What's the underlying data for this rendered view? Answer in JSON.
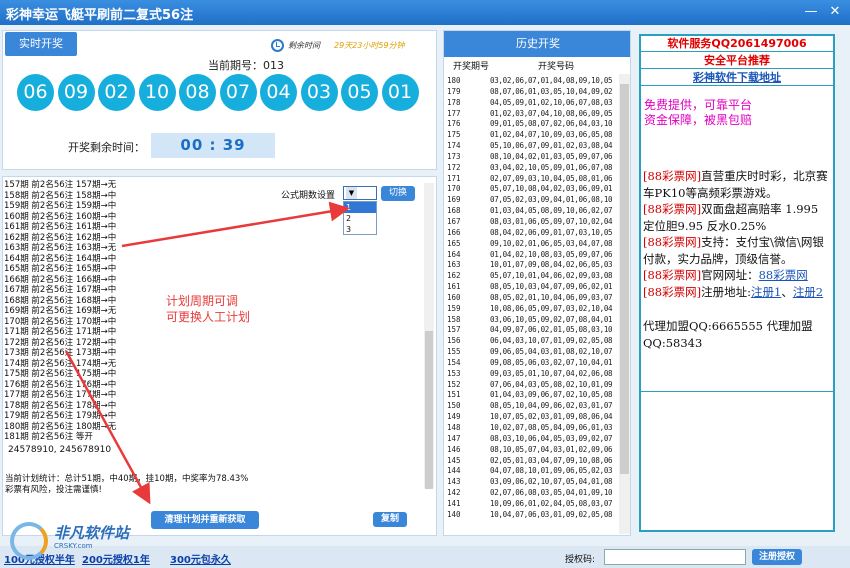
{
  "window": {
    "title": "彩神幸运飞艇平刷前二复式56注",
    "min_glyph": "—",
    "close_glyph": "✕"
  },
  "live": {
    "button_label": "实时开奖",
    "countdown_label": "剩余时间",
    "countdown_value": "29天23小时59分钟",
    "period_text": "当前期号：013",
    "balls": [
      "06",
      "09",
      "02",
      "10",
      "08",
      "07",
      "04",
      "03",
      "05",
      "01"
    ],
    "remain_label": "开奖剩余时间：",
    "timer": "00 : 39"
  },
  "plan": {
    "rows": [
      "157期 前2名56注 157期→无",
      "158期 前2名56注 158期→中",
      "159期 前2名56注 159期→中",
      "160期 前2名56注 160期→中",
      "161期 前2名56注 161期→中",
      "162期 前2名56注 162期→中",
      "163期 前2名56注 163期→无",
      "164期 前2名56注 164期→中",
      "165期 前2名56注 165期→中",
      "166期 前2名56注 166期→中",
      "167期 前2名56注 167期→中",
      "168期 前2名56注 168期→中",
      "169期 前2名56注 169期→无",
      "170期 前2名56注 170期→中",
      "171期 前2名56注 171期→中",
      "172期 前2名56注 172期→中",
      "173期 前2名56注 173期→中",
      "174期 前2名56注 174期→无",
      "175期 前2名56注 175期→中",
      "176期 前2名56注 176期→中",
      "177期 前2名56注 177期→中",
      "178期 前2名56注 178期→中",
      "179期 前2名56注 179期→中",
      "180期 前2名56注 180期→无",
      "181期 前2名56注 等开"
    ],
    "formula_label": "公式期数设置",
    "formula_value": "1",
    "formula_options": [
      "1",
      "2",
      "3"
    ],
    "switch_label": "切换",
    "annotation_line1": "计划周期可调",
    "annotation_line2": "可更换人工计划",
    "numbers": "24578910, 245678910",
    "stats_line1": "当前计划统计：总计51期，中40期，挂10期，中奖率为78.43%",
    "stats_line2": "彩票有风险，投注需谨慎!",
    "clear_label": "清理计划并重新获取",
    "copy_label": "复制"
  },
  "history": {
    "title": "历史开奖",
    "col_period": "开奖期号",
    "col_numbers": "开奖号码",
    "rows": [
      [
        "180",
        "03,02,06,07,01,04,08,09,10,05"
      ],
      [
        "179",
        "08,07,06,01,03,05,10,04,09,02"
      ],
      [
        "178",
        "04,05,09,01,02,10,06,07,08,03"
      ],
      [
        "177",
        "01,02,03,07,04,10,08,06,09,05"
      ],
      [
        "176",
        "09,01,05,08,07,02,06,04,03,10"
      ],
      [
        "175",
        "01,02,04,07,10,09,03,06,05,08"
      ],
      [
        "174",
        "05,10,06,07,09,01,02,03,08,04"
      ],
      [
        "173",
        "08,10,04,02,01,03,05,09,07,06"
      ],
      [
        "172",
        "03,04,02,10,05,09,01,06,07,08"
      ],
      [
        "171",
        "02,07,09,03,10,04,05,08,01,06"
      ],
      [
        "170",
        "05,07,10,08,04,02,03,06,09,01"
      ],
      [
        "169",
        "07,05,02,03,09,04,01,06,08,10"
      ],
      [
        "168",
        "01,03,04,05,08,09,10,06,02,07"
      ],
      [
        "167",
        "08,03,01,06,05,09,07,10,02,04"
      ],
      [
        "166",
        "08,04,02,06,09,01,07,03,10,05"
      ],
      [
        "165",
        "09,10,02,01,06,05,03,04,07,08"
      ],
      [
        "164",
        "01,04,02,10,08,03,05,09,07,06"
      ],
      [
        "163",
        "10,01,07,09,08,04,02,06,05,03"
      ],
      [
        "162",
        "05,07,10,01,04,06,02,09,03,08"
      ],
      [
        "161",
        "08,05,10,03,04,07,09,06,02,01"
      ],
      [
        "160",
        "08,05,02,01,10,04,06,09,03,07"
      ],
      [
        "159",
        "10,08,06,05,09,07,03,02,10,04"
      ],
      [
        "158",
        "03,06,10,05,09,02,07,08,04,01"
      ],
      [
        "157",
        "04,09,07,06,02,01,05,08,03,10"
      ],
      [
        "156",
        "06,04,03,10,07,01,09,02,05,08"
      ],
      [
        "155",
        "09,06,05,04,03,01,08,02,10,07"
      ],
      [
        "154",
        "09,08,05,06,03,02,07,10,04,01"
      ],
      [
        "153",
        "09,03,05,01,10,07,04,02,06,08"
      ],
      [
        "152",
        "07,06,04,03,05,08,02,10,01,09"
      ],
      [
        "151",
        "01,04,03,09,06,07,02,10,05,08"
      ],
      [
        "150",
        "08,05,10,04,09,06,02,03,01,07"
      ],
      [
        "149",
        "10,07,05,02,03,01,09,08,06,04"
      ],
      [
        "148",
        "10,02,07,08,05,04,09,06,01,03"
      ],
      [
        "147",
        "08,03,10,06,04,05,03,09,02,07"
      ],
      [
        "146",
        "08,10,05,07,04,03,01,02,09,06"
      ],
      [
        "145",
        "02,05,01,03,04,07,09,10,08,06"
      ],
      [
        "144",
        "04,07,08,10,01,09,06,05,02,03"
      ],
      [
        "143",
        "03,09,06,02,10,07,05,04,01,08"
      ],
      [
        "142",
        "02,07,06,08,03,05,04,01,09,10"
      ],
      [
        "141",
        "10,09,06,01,02,04,05,08,03,07"
      ],
      [
        "140",
        "10,04,07,06,03,01,09,02,05,08"
      ]
    ]
  },
  "right": {
    "header1": "软件服务QQ2061497006",
    "header2": "安全平台推荐",
    "header3": "彩神软件下载地址",
    "free_line1": "免费提供，可靠平台",
    "free_line2": "资金保障，被黑包赔",
    "ad1_tag": "[88彩票网]",
    "ad1_text": "直营重庆时时彩，北京赛车PK10等高频彩票游戏。",
    "ad2_tag": "[88彩票网]",
    "ad2_text": "双面盘超高赔率 1.995 定位胆9.95 反水0.25%",
    "ad3_tag": "[88彩票网]",
    "ad3_text": "支持：支付宝\\微信\\网银付款，实力品牌，顶级信誉。",
    "ad4_tag": "[88彩票网]",
    "ad4_text": "官网网址：",
    "ad4_link": "88彩票网",
    "ad5_tag": "[88彩票网]",
    "ad5_text": "注册地址:",
    "ad5_link1": "注册1",
    "ad5_sep": "、",
    "ad5_link2": "注册2",
    "agent_text": "代理加盟QQ:6665555 代理加盟QQ:58343"
  },
  "bottom": {
    "link1": "100元授权半年",
    "link2": "200元授权1年",
    "link3": "300元包永久",
    "auth_label": "授权码:",
    "register_label": "注册授权",
    "watermark_title": "非凡软件站",
    "watermark_sub": "CRSKY.com"
  },
  "colors": {
    "accent": "#3a86d8",
    "ball": "#16aedc",
    "annotation": "#e83a3a"
  }
}
